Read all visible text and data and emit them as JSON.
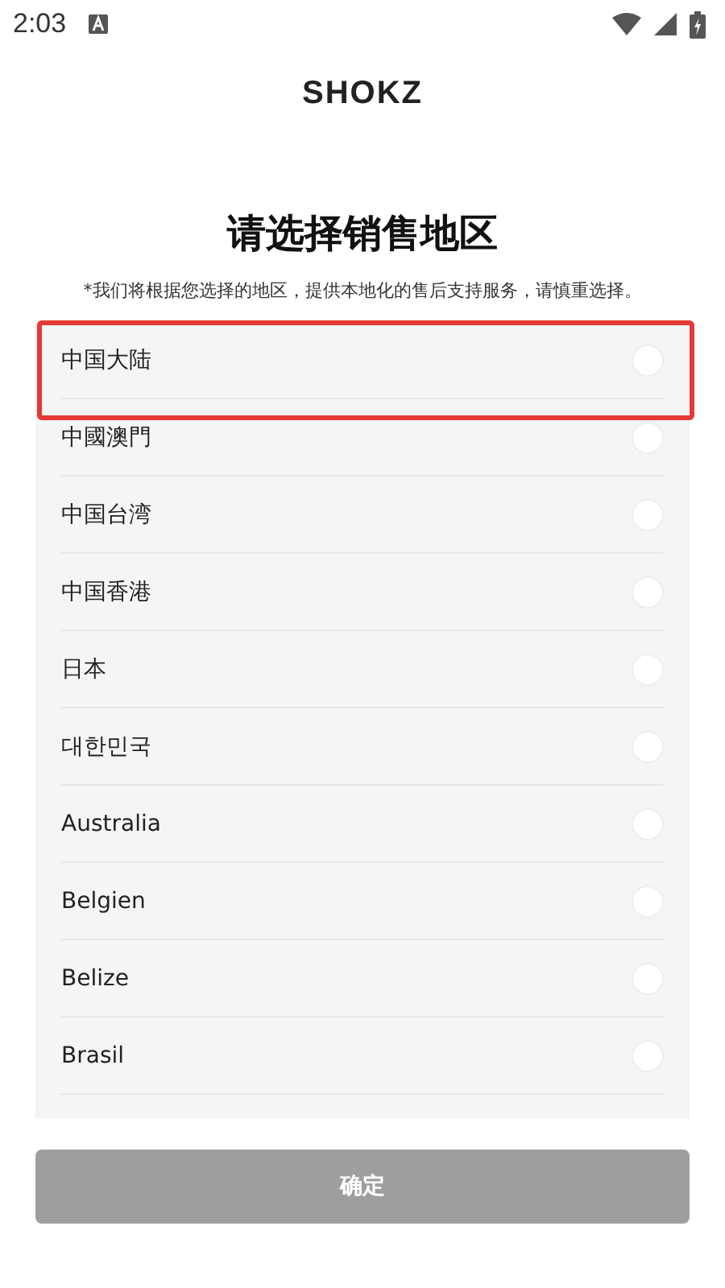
{
  "status_bar": {
    "time": "2:03"
  },
  "logo": "SHOKZ",
  "title": "请选择销售地区",
  "subtitle": "*我们将根据您选择的地区，提供本地化的售后支持服务，请慎重选择。",
  "regions": [
    {
      "name": "中国大陆",
      "selected": false,
      "highlighted": true
    },
    {
      "name": "中國澳門",
      "selected": false,
      "highlighted": false
    },
    {
      "name": "中国台湾",
      "selected": false,
      "highlighted": false
    },
    {
      "name": "中国香港",
      "selected": false,
      "highlighted": false
    },
    {
      "name": "日本",
      "selected": false,
      "highlighted": false
    },
    {
      "name": "대한민국",
      "selected": false,
      "highlighted": false
    },
    {
      "name": "Australia",
      "selected": false,
      "highlighted": false
    },
    {
      "name": "Belgien",
      "selected": false,
      "highlighted": false
    },
    {
      "name": "Belize",
      "selected": false,
      "highlighted": false
    },
    {
      "name": "Brasil",
      "selected": false,
      "highlighted": false
    }
  ],
  "confirm_button": {
    "label": "确定",
    "disabled": true
  }
}
